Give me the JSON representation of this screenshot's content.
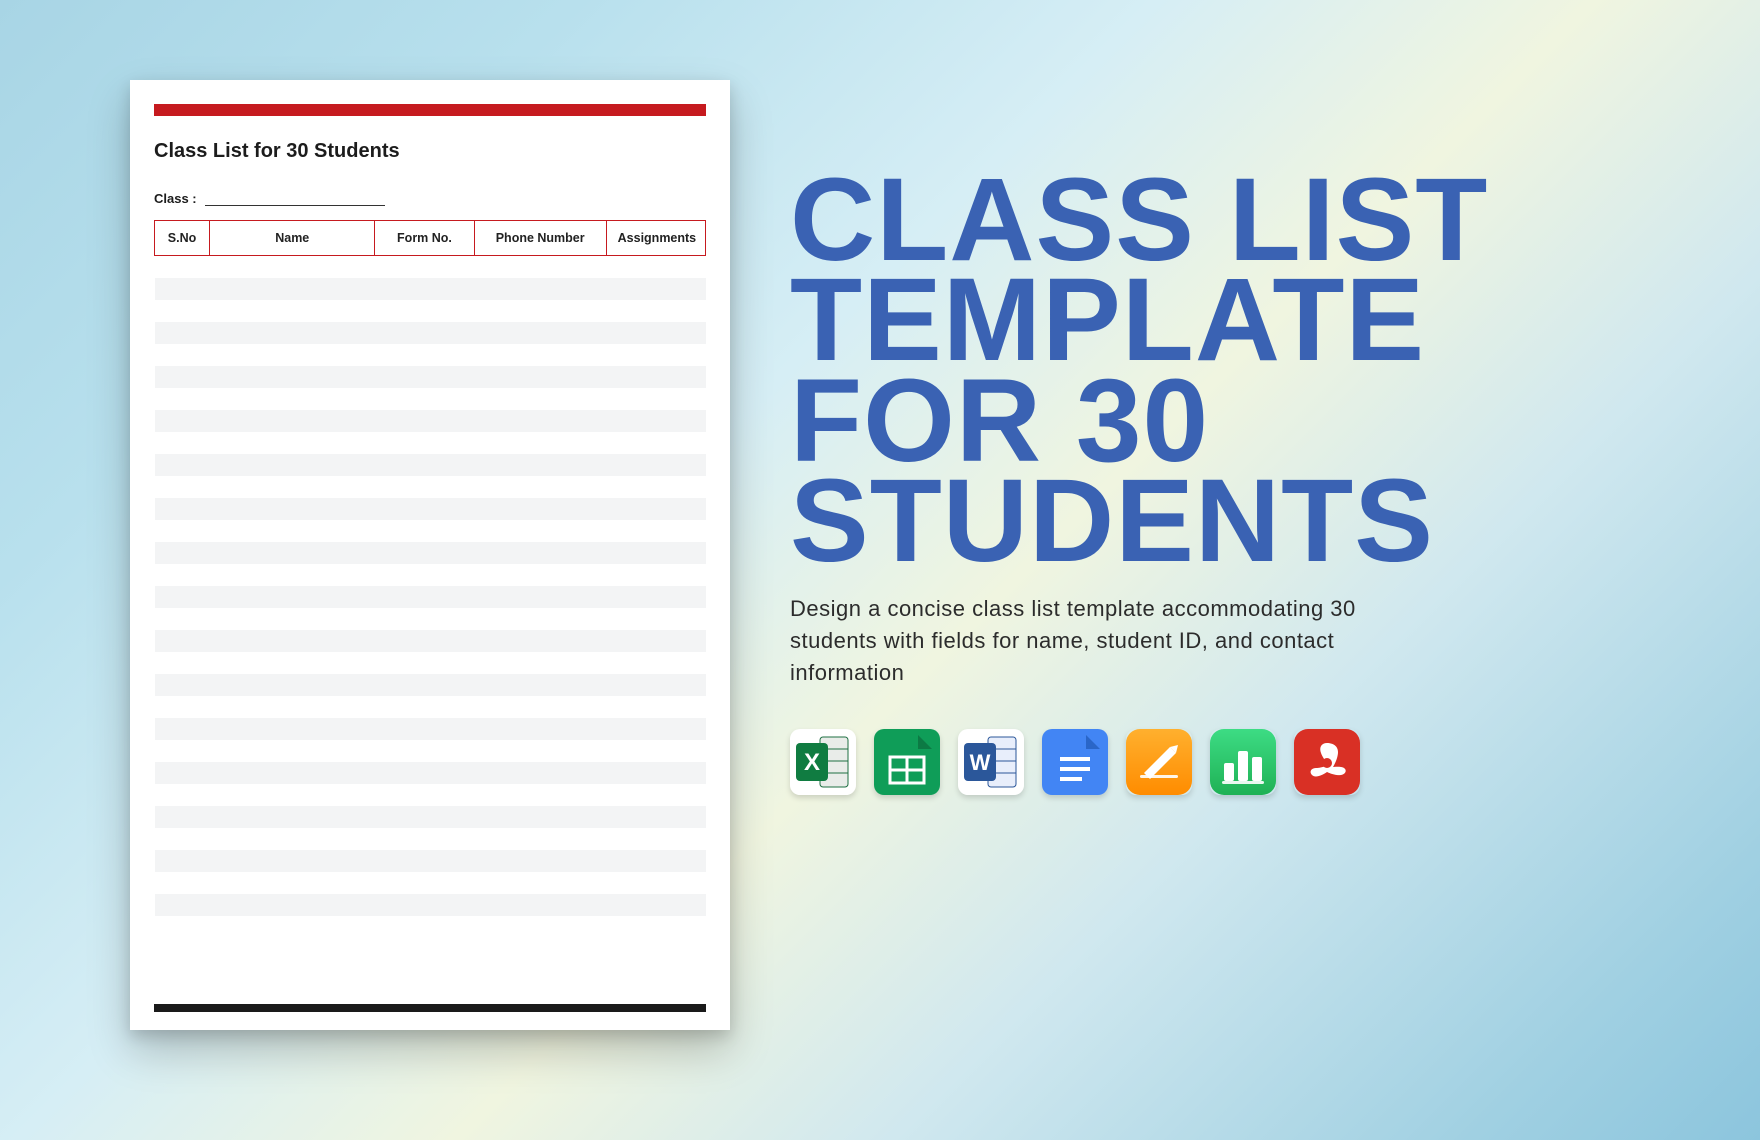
{
  "document": {
    "title": "Class List for 30 Students",
    "class_label": "Class :",
    "columns": {
      "sno": "S.No",
      "name": "Name",
      "form": "Form No.",
      "phone": "Phone Number",
      "assignments": "Assignments"
    },
    "row_count": 30
  },
  "promo": {
    "headline_l1": "CLASS LIST",
    "headline_l2": "TEMPLATE",
    "headline_l3": "FOR 30",
    "headline_l4": "STUDENTS",
    "description": "Design a concise class list template accommodating 30 students with fields for name, student ID, and contact information",
    "formats": [
      "excel",
      "google-sheets",
      "word",
      "google-docs",
      "apple-pages",
      "apple-numbers",
      "pdf"
    ]
  },
  "colors": {
    "accent_red": "#c61a1f",
    "title_blue": "#3a62b3"
  }
}
